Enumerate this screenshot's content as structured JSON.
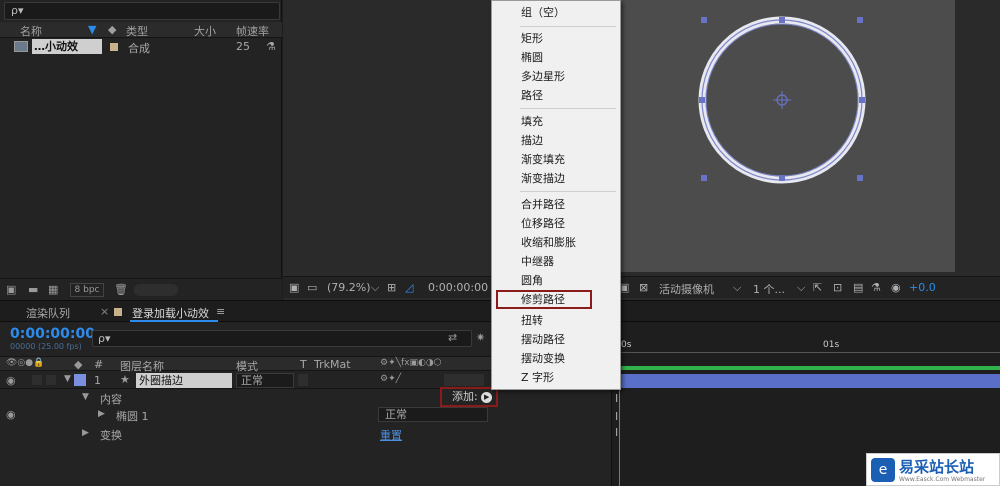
{
  "project": {
    "search_placeholder": "ρ▾",
    "columns": {
      "name": "名称",
      "type": "类型",
      "size": "大小",
      "fps": "帧速率"
    },
    "row": {
      "name": "…小动效",
      "type": "合成",
      "fps": "25"
    },
    "bpc": "8 bpc"
  },
  "viewer": {
    "zoom": "(79.2%)",
    "timecode": "0:00:00:00",
    "camera": "活动摄像机",
    "views": "1 个...",
    "exposure": "+0.0"
  },
  "timeline": {
    "tab_render": "渲染队列",
    "tab_comp": "登录加载小动效",
    "current_time": "0:00:00:00",
    "fps_info": "00000 (25.00 fps)",
    "search_placeholder": "ρ▾",
    "col_hash": "#",
    "col_layer_name": "图层名称",
    "col_mode": "模式",
    "col_t": "T",
    "col_trkmat": "TrkMat",
    "layer_index": "1",
    "layer_name": "外圈描边",
    "layer_mode": "正常",
    "contents_label": "内容",
    "add_label": "添加:",
    "ellipse_label": "椭圆 1",
    "ellipse_mode": "正常",
    "transform_label": "变换",
    "reset_label": "重置",
    "ruler_0": "0s",
    "ruler_1": "01s"
  },
  "menu": {
    "items": [
      "组（空）",
      "矩形",
      "椭圆",
      "多边星形",
      "路径",
      "填充",
      "描边",
      "渐变填充",
      "渐变描边",
      "合并路径",
      "位移路径",
      "收缩和膨胀",
      "中继器",
      "圆角",
      "修剪路径",
      "扭转",
      "摆动路径",
      "摆动变换",
      "Z 字形"
    ]
  },
  "watermark": {
    "text": "易采站长站",
    "sub": "Www.Easck.Com Webmaster"
  },
  "colors": {
    "accent": "#2d8ceb",
    "highlight_box": "#8b1a1a",
    "layer_bar": "#5a6fc8",
    "time_green": "#2fb34a",
    "label_blue": "#7b8fe0"
  }
}
